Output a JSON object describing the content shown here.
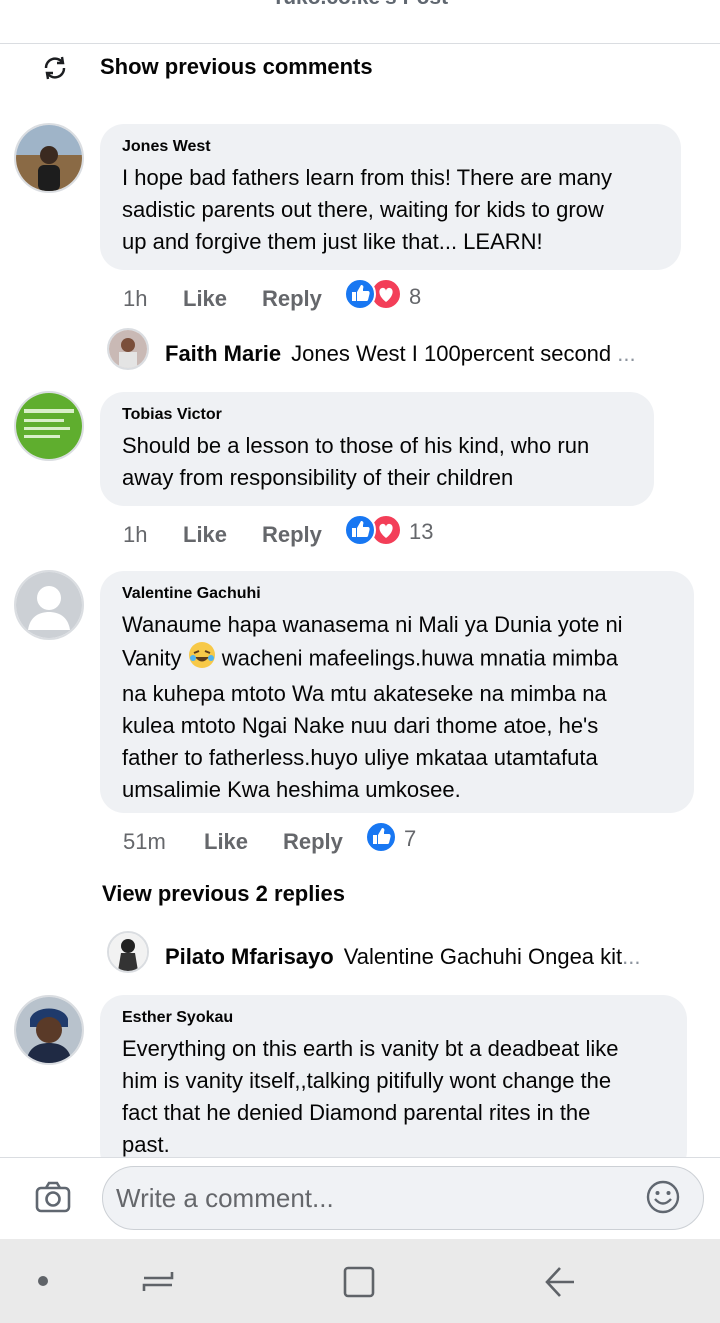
{
  "header": {
    "title": "Tuko.co.ke's Post"
  },
  "show_previous_label": "Show previous comments",
  "comments": [
    {
      "author": "Jones West",
      "text_lines": [
        "I hope bad fathers learn from this! There are many",
        "sadistic parents out there, waiting for kids to grow",
        "up and forgive them just like that... LEARN!"
      ],
      "time": "1h",
      "like": "Like",
      "reply": "Reply",
      "reaction_count": "8",
      "reply_preview": {
        "name": "Faith Marie",
        "text": "Jones West I 100percent second",
        "ellipsis": "..."
      }
    },
    {
      "author": "Tobias Victor",
      "text_lines": [
        "Should be a lesson to those of his kind, who run",
        "away from responsibility of their children"
      ],
      "time": "1h",
      "like": "Like",
      "reply": "Reply",
      "reaction_count": "13"
    },
    {
      "author": "Valentine Gachuhi",
      "text_lines": [
        "Wanaume hapa wanasema ni Mali ya Dunia yote ni",
        "Vanity",
        "wacheni mafeelings.huwa mnatia mimba",
        "na kuhepa mtoto Wa mtu akateseke  na mimba na",
        "kulea mtoto Ngai Nake nuu dari thome atoe, he's",
        "father to fatherless.huyo uliye mkataa utamtafuta",
        "umsalimie Kwa heshima umkosee."
      ],
      "time": "51m",
      "like": "Like",
      "reply": "Reply",
      "reaction_count": "7",
      "view_previous": "View previous 2 replies",
      "reply_preview": {
        "name": "Pilato Mfarisayo",
        "text": "Valentine Gachuhi Ongea kit",
        "ellipsis": "..."
      }
    },
    {
      "author": "Esther Syokau",
      "text_lines": [
        "Everything on this earth is vanity bt a deadbeat like",
        "him is vanity itself,,talking pitifully wont change the",
        "fact that  he denied Diamond parental rites in the",
        "past."
      ]
    }
  ],
  "composer": {
    "placeholder": "Write a comment..."
  },
  "colors": {
    "like_blue": "#1877f2",
    "love_red": "#f33e58",
    "bubble": "#eff1f4",
    "meta_gray": "#65676b"
  },
  "icons": [
    "back-arrow-icon",
    "refresh-icon",
    "like-icon",
    "love-icon",
    "camera-icon",
    "emoji-icon",
    "home-dot-icon",
    "recents-icon",
    "overview-icon",
    "nav-back-icon"
  ]
}
